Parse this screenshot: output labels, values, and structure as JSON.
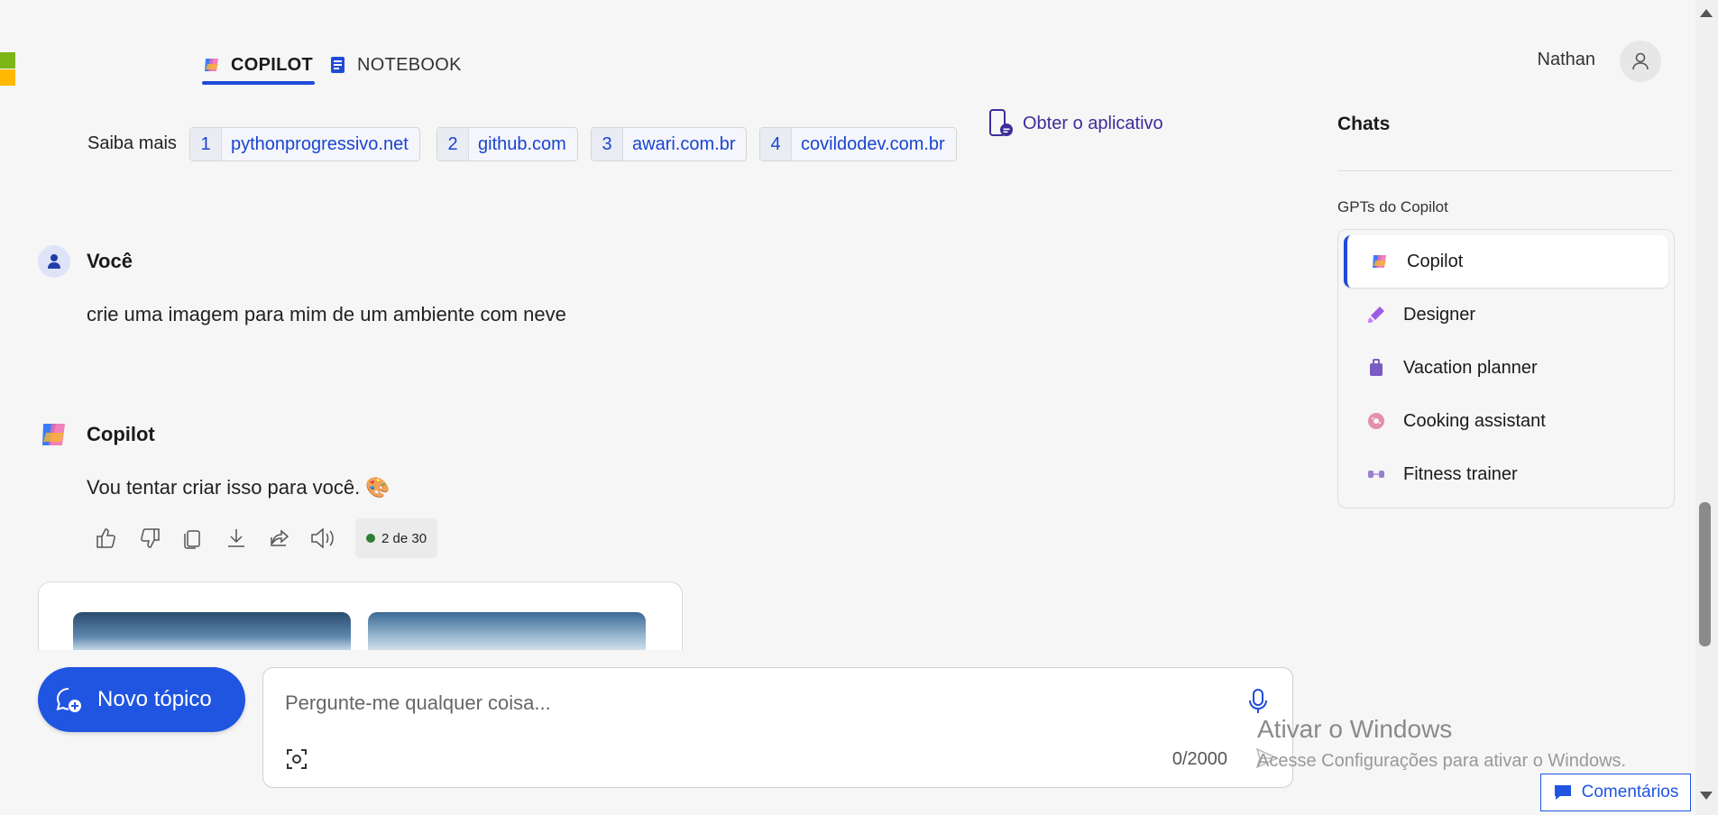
{
  "tabs": [
    {
      "label": "COPILOT",
      "icon": "copilot-icon",
      "active": true
    },
    {
      "label": "NOTEBOOK",
      "icon": "notebook-icon",
      "active": false
    }
  ],
  "user": {
    "name": "Nathan",
    "icon": "person-icon"
  },
  "sources": {
    "label": "Saiba mais",
    "items": [
      {
        "num": "1",
        "site": "pythonprogressivo.net"
      },
      {
        "num": "2",
        "site": "github.com"
      },
      {
        "num": "3",
        "site": "awari.com.br"
      },
      {
        "num": "4",
        "site": "covildodev.com.br"
      }
    ]
  },
  "get_app": {
    "label": "Obter o aplicativo",
    "icon": "phone-chat-icon"
  },
  "messages": [
    {
      "author": "Você",
      "text": "crie uma imagem para mim de um ambiente com neve"
    },
    {
      "author": "Copilot",
      "text": "Vou tentar criar isso para você. 🎨"
    }
  ],
  "actions": {
    "icons": [
      "thumbs-up-icon",
      "thumbs-down-icon",
      "copy-icon",
      "download-icon",
      "share-icon",
      "read-aloud-icon"
    ],
    "counter": "2 de 30",
    "status_color": "#2e7d32"
  },
  "composer": {
    "new_topic_label": "Novo tópico",
    "placeholder": "Pergunte-me qualquer coisa...",
    "char_count": "0/2000"
  },
  "watermark": {
    "title": "Ativar o Windows",
    "subtitle": "Acesse Configurações para ativar o Windows."
  },
  "feedback_label": "Comentários",
  "sidebar": {
    "chats_title": "Chats",
    "gpts_title": "GPTs do Copilot",
    "gpts": [
      {
        "label": "Copilot",
        "icon": "copilot-icon",
        "active": true
      },
      {
        "label": "Designer",
        "icon": "designer-icon",
        "active": false
      },
      {
        "label": "Vacation planner",
        "icon": "suitcase-icon",
        "active": false
      },
      {
        "label": "Cooking assistant",
        "icon": "donut-icon",
        "active": false
      },
      {
        "label": "Fitness trainer",
        "icon": "dumbbell-icon",
        "active": false
      }
    ]
  },
  "colors": {
    "accent": "#1f4bd8",
    "link": "#1a44d0",
    "new_topic": "#1f55e0"
  }
}
